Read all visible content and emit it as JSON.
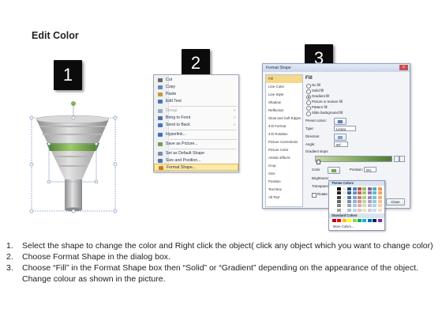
{
  "title": "Edit Color",
  "badges": [
    "1",
    "2",
    "3"
  ],
  "context_menu": {
    "items": [
      {
        "label": "Cut",
        "color": "#6a6a6a",
        "disabled": false,
        "arrow": ""
      },
      {
        "label": "Copy",
        "color": "#6a86b8",
        "disabled": false,
        "arrow": ""
      },
      {
        "label": "Paste",
        "color": "#c59a3a",
        "disabled": false,
        "arrow": ""
      },
      {
        "label": "Edit Text",
        "color": "#4a73b5",
        "disabled": false,
        "arrow": ""
      },
      {
        "label": "Group",
        "color": "#9aa6b6",
        "disabled": true,
        "arrow": "›"
      },
      {
        "label": "Bring to Front",
        "color": "#4a73b5",
        "disabled": false,
        "arrow": "›"
      },
      {
        "label": "Send to Back",
        "color": "#4a73b5",
        "disabled": false,
        "arrow": "›"
      },
      {
        "label": "Hyperlink...",
        "color": "#3d6fc4",
        "disabled": false,
        "arrow": ""
      },
      {
        "label": "Save as Picture...",
        "color": "#7a9a4a",
        "disabled": false,
        "arrow": ""
      },
      {
        "label": "Set as Default Shape",
        "color": "#7f8c9c",
        "disabled": false,
        "arrow": ""
      },
      {
        "label": "Size and Position...",
        "color": "#4a73b5",
        "disabled": false,
        "arrow": ""
      },
      {
        "label": "Format Shape...",
        "color": "#c87c2c",
        "disabled": false,
        "arrow": ""
      }
    ]
  },
  "dialog": {
    "title": "Format Shape",
    "close": "x",
    "nav": [
      "Fill",
      "Line Color",
      "Line Style",
      "Shadow",
      "Reflection",
      "Glow and Soft Edges",
      "3-D Format",
      "3-D Rotation",
      "Picture Corrections",
      "Picture Color",
      "Artistic Effects",
      "Crop",
      "Size",
      "Position",
      "Text Box",
      "Alt Text"
    ],
    "heading": "Fill",
    "options": [
      "No fill",
      "Solid fill",
      "Gradient fill",
      "Picture or texture fill",
      "Pattern fill",
      "Slide background fill"
    ],
    "selected_option": "Gradient fill",
    "preset_label": "Preset colors:",
    "type_label": "Type:",
    "type_value": "Linear",
    "direction_label": "Direction:",
    "angle_label": "Angle:",
    "angle_value": "90°",
    "stops_label": "Gradient stops",
    "color_label": "Color",
    "position_label": "Position:",
    "position_value": "0%",
    "brightness_label": "Brightness:",
    "transparency_label": "Transparency:",
    "rotate_label": "Rotate with shape",
    "theme_colors_label": "Theme Colors",
    "standard_colors_label": "Standard Colors",
    "more_colors_label": "More Colors...",
    "close_button": "Close"
  },
  "colors": {
    "funnel_band": "#76a84c",
    "gradient_bar_end": "#4f7a2e",
    "menu_highlight": "#fde9a8"
  },
  "instructions": [
    {
      "num": "1.",
      "text": "Select the shape to change the color and Right click the object( click any object which you want to change color)"
    },
    {
      "num": "2.",
      "text": "Choose Format Shape in the dialog box."
    },
    {
      "num": "3.",
      "text": "Choose “Fill” in the Format Shape box then “Solid” or “Gradient” depending on the appearance of the object. Change colour as shown in the picture."
    }
  ]
}
